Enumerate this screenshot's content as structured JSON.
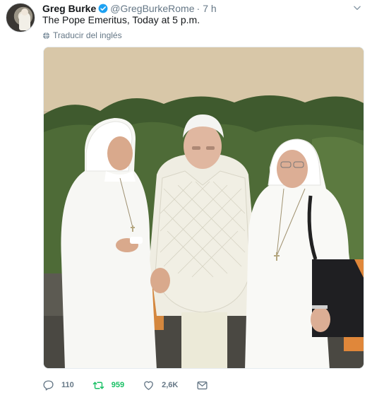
{
  "tweet": {
    "author": {
      "name": "Greg Burke",
      "handle": "@GregBurkeRome",
      "verified": true
    },
    "separator": "·",
    "time": "7 h",
    "text": "The Pope Emeritus, Today at 5 p.m.",
    "translate_label": "Traducir del inglés",
    "actions": {
      "replies": "110",
      "retweets": "959",
      "likes": "2,6K"
    },
    "colors": {
      "verified_blue": "#1da1f2",
      "retweet_active": "#17bf63",
      "secondary_text": "#657786"
    },
    "icons": {
      "reply": "reply-icon",
      "retweet": "retweet-icon",
      "like": "heart-icon",
      "message": "envelope-icon",
      "translate": "globe-icon",
      "menu": "chevron-down-icon"
    }
  }
}
